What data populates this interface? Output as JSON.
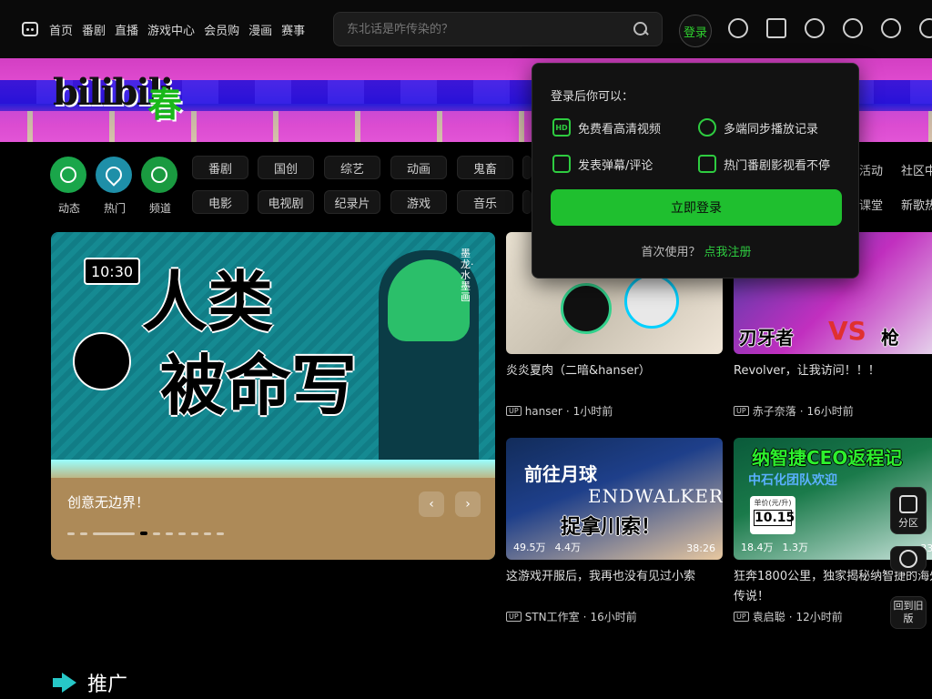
{
  "nav": {
    "links": [
      "首页",
      "番剧",
      "直播",
      "游戏中心",
      "会员购",
      "漫画",
      "赛事"
    ],
    "search_placeholder": "东北话是咋传染的？",
    "login_avatar": "登录",
    "icons": [
      "history-icon",
      "message-icon",
      "dynamic-icon",
      "favorite-icon",
      "clock-icon",
      "creative-icon"
    ]
  },
  "banner": {
    "logo_text": "bilibili",
    "logo_sub": "春"
  },
  "channels": {
    "big": [
      {
        "label": "动态",
        "icon": "dynamic-icon"
      },
      {
        "label": "热门",
        "icon": "hot-icon"
      },
      {
        "label": "频道",
        "icon": "channel-icon"
      }
    ],
    "row1": [
      "番剧",
      "国创",
      "综艺",
      "动画",
      "鬼畜"
    ],
    "row2": [
      "电影",
      "电视剧",
      "纪录片",
      "游戏",
      "音乐"
    ],
    "extra": [
      "活动",
      "社区中",
      "课堂",
      "新歌热"
    ]
  },
  "carousel": {
    "title": "创意无边界！",
    "art": {
      "clock": "10:30",
      "line1": "人类",
      "line2": "被命写",
      "stamp": "墨龙·水墨画"
    },
    "dots": 11,
    "active_dot": 3
  },
  "videos": [
    {
      "title": "炎炎夏肉（二暗&hanser）",
      "up": "hanser",
      "time": "1小时前"
    },
    {
      "title": "Revolver，让我访问！！！",
      "up": "赤子奈落",
      "time": "16小时前",
      "thumb": {
        "a": "刃牙者",
        "vs": "VS",
        "b": "枪"
      }
    },
    {
      "title": "这游戏开服后，我再也没有见过小索",
      "up": "STN工作室",
      "time": "16小时前",
      "thumb": {
        "a": "前往月球",
        "b": "ENDWALKER",
        "c": "捉拿川索！"
      },
      "views": "49.5万",
      "likes": "4.4万",
      "duration": "38:26"
    },
    {
      "title": "狂奔1800公里，独家揭秘纳智捷的海外传说！",
      "up": "袁启聪",
      "time": "12小时前",
      "thumb": {
        "a": "纳智捷CEO返程记",
        "b": "中石化团队欢迎",
        "price_label": "单价(元/升)",
        "price": "10.15"
      },
      "views": "18.4万",
      "likes": "1.3万",
      "duration": "33:1"
    }
  ],
  "login_popup": {
    "title": "登录后你可以：",
    "items": [
      {
        "icon": "hd-icon",
        "badge": "HD",
        "label": "免费看高清视频"
      },
      {
        "icon": "sync-history-icon",
        "badge": "",
        "label": "多端同步播放记录"
      },
      {
        "icon": "danmaku-icon",
        "badge": "",
        "label": "发表弹幕/评论"
      },
      {
        "icon": "video-play-icon",
        "badge": "",
        "label": "热门番剧影视看不停"
      }
    ],
    "button": "立即登录",
    "footer_text": "首次使用？",
    "footer_link": "点我注册"
  },
  "side": {
    "category": "分区",
    "back_old": "回到旧版"
  },
  "promo": {
    "label": "推广"
  }
}
